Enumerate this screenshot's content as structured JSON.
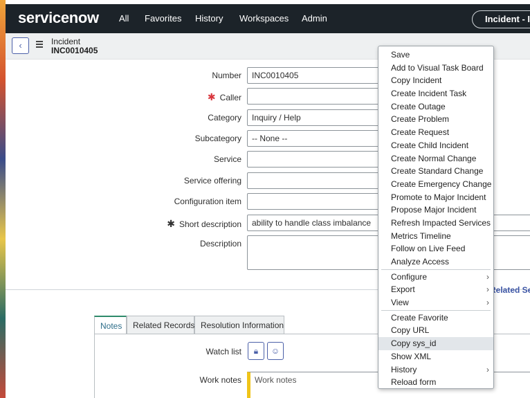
{
  "nav": {
    "logo": "servicenow",
    "items": [
      "All",
      "Favorites",
      "History",
      "Workspaces",
      "Admin"
    ],
    "context_pill": "Incident - I"
  },
  "record": {
    "type": "Incident",
    "number": "INC0010405"
  },
  "form": {
    "number_label": "Number",
    "number_value": "INC0010405",
    "caller_label": "Caller",
    "caller_value": "",
    "category_label": "Category",
    "category_value": "Inquiry / Help",
    "subcategory_label": "Subcategory",
    "subcategory_value": "-- None --",
    "service_label": "Service",
    "service_offering_label": "Service offering",
    "config_item_label": "Configuration item",
    "short_desc_label": "Short description",
    "short_desc_value": "ability to handle class imbalance",
    "description_label": "Description",
    "related_search": "Related Sea"
  },
  "tabs": [
    "Notes",
    "Related Records",
    "Resolution Information"
  ],
  "notes": {
    "watch_list_label": "Watch list",
    "work_notes_label": "Work notes",
    "work_notes_placeholder": "Work notes"
  },
  "context_menu": {
    "items": [
      {
        "label": "Save"
      },
      {
        "label": "Add to Visual Task Board"
      },
      {
        "label": "Copy Incident"
      },
      {
        "label": "Create Incident Task"
      },
      {
        "label": "Create Outage"
      },
      {
        "label": "Create Problem"
      },
      {
        "label": "Create Request"
      },
      {
        "label": "Create Child Incident"
      },
      {
        "label": "Create Normal Change"
      },
      {
        "label": "Create Standard Change"
      },
      {
        "label": "Create Emergency Change"
      },
      {
        "label": "Promote to Major Incident"
      },
      {
        "label": "Propose Major Incident"
      },
      {
        "label": "Refresh Impacted Services"
      },
      {
        "label": "Metrics Timeline"
      },
      {
        "label": "Follow on Live Feed"
      },
      {
        "label": "Analyze Access"
      },
      {
        "label": "Configure",
        "submenu": true
      },
      {
        "label": "Export",
        "submenu": true
      },
      {
        "label": "View",
        "submenu": true
      },
      {
        "label": "Create Favorite"
      },
      {
        "label": "Copy URL"
      },
      {
        "label": "Copy sys_id",
        "highlighted": true
      },
      {
        "label": "Show XML"
      },
      {
        "label": "History",
        "submenu": true
      },
      {
        "label": "Reload form"
      }
    ]
  },
  "colors": {
    "nav_bg": "#1c2329",
    "accent": "#4a5fa8",
    "required": "#d9373e",
    "work_notes_bar": "#f0c419"
  }
}
